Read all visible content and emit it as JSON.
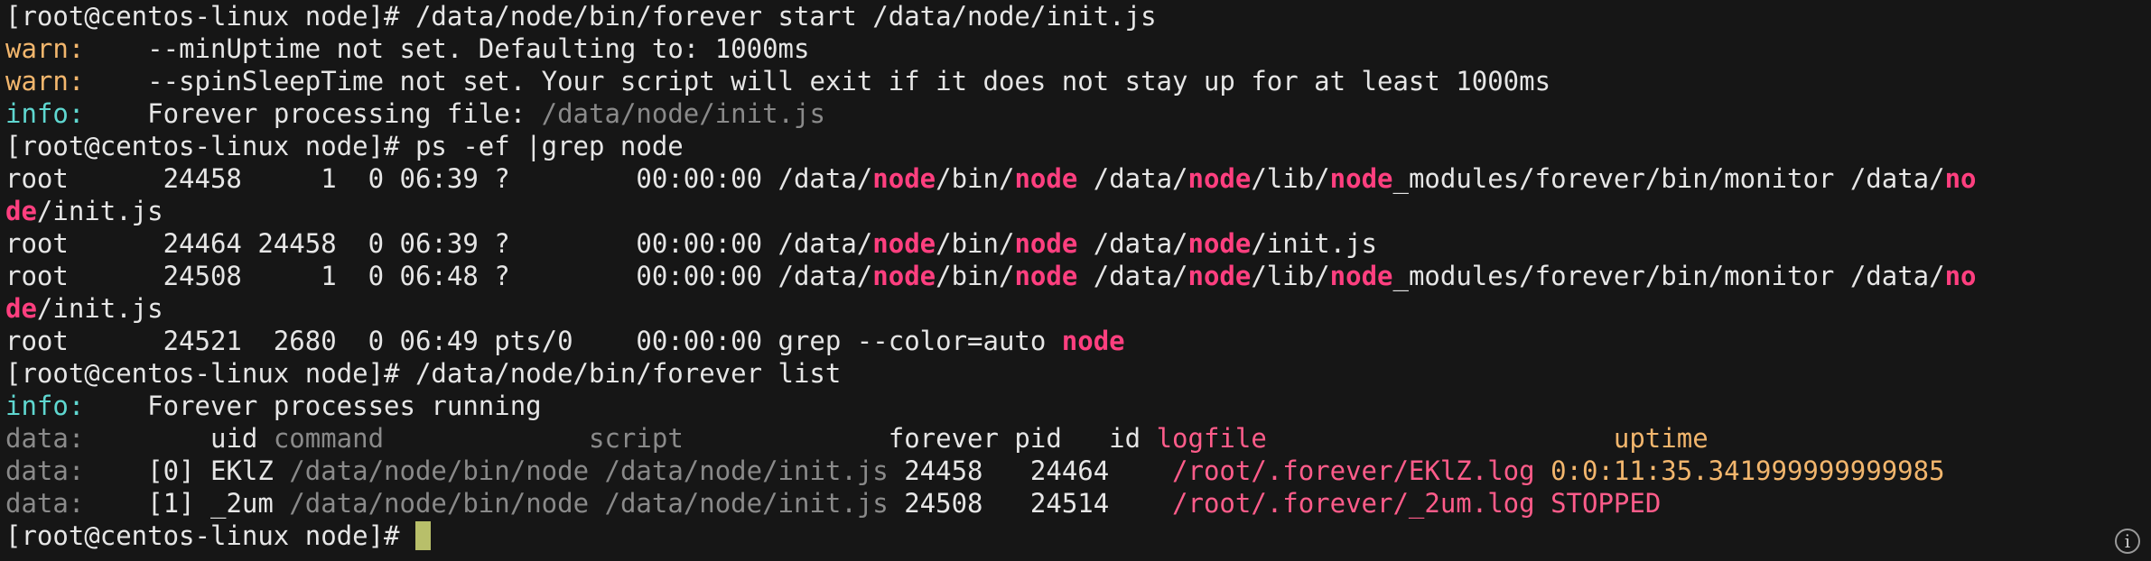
{
  "lines": [
    {
      "segments": [
        {
          "t": "[root@centos-linux node]# /data/node/bin/forever start /data/node/init.js",
          "c": ""
        }
      ]
    },
    {
      "segments": [
        {
          "t": "warn:",
          "c": "warn"
        },
        {
          "t": "    --minUptime not set. Defaulting to: 1000ms",
          "c": ""
        }
      ]
    },
    {
      "segments": [
        {
          "t": "warn:",
          "c": "warn"
        },
        {
          "t": "    --spinSleepTime not set. Your script will exit if it does not stay up for at least 1000ms",
          "c": ""
        }
      ]
    },
    {
      "segments": [
        {
          "t": "info:",
          "c": "info"
        },
        {
          "t": "    Forever processing file: ",
          "c": ""
        },
        {
          "t": "/data/node/init.js",
          "c": "dim"
        }
      ]
    },
    {
      "segments": [
        {
          "t": "[root@centos-linux node]# ps -ef |grep node",
          "c": ""
        }
      ]
    },
    {
      "segments": [
        {
          "t": "root      24458     1  0 06:39 ?        00:00:00 /data/",
          "c": ""
        },
        {
          "t": "node",
          "c": "match"
        },
        {
          "t": "/bin/",
          "c": ""
        },
        {
          "t": "node",
          "c": "match"
        },
        {
          "t": " /data/",
          "c": ""
        },
        {
          "t": "node",
          "c": "match"
        },
        {
          "t": "/lib/",
          "c": ""
        },
        {
          "t": "node",
          "c": "match"
        },
        {
          "t": "_modules/forever/bin/monitor /data/",
          "c": ""
        },
        {
          "t": "no",
          "c": "match"
        }
      ]
    },
    {
      "segments": [
        {
          "t": "de",
          "c": "match"
        },
        {
          "t": "/init.js",
          "c": ""
        }
      ]
    },
    {
      "segments": [
        {
          "t": "root      24464 24458  0 06:39 ?        00:00:00 /data/",
          "c": ""
        },
        {
          "t": "node",
          "c": "match"
        },
        {
          "t": "/bin/",
          "c": ""
        },
        {
          "t": "node",
          "c": "match"
        },
        {
          "t": " /data/",
          "c": ""
        },
        {
          "t": "node",
          "c": "match"
        },
        {
          "t": "/init.js",
          "c": ""
        }
      ]
    },
    {
      "segments": [
        {
          "t": "root      24508     1  0 06:48 ?        00:00:00 /data/",
          "c": ""
        },
        {
          "t": "node",
          "c": "match"
        },
        {
          "t": "/bin/",
          "c": ""
        },
        {
          "t": "node",
          "c": "match"
        },
        {
          "t": " /data/",
          "c": ""
        },
        {
          "t": "node",
          "c": "match"
        },
        {
          "t": "/lib/",
          "c": ""
        },
        {
          "t": "node",
          "c": "match"
        },
        {
          "t": "_modules/forever/bin/monitor /data/",
          "c": ""
        },
        {
          "t": "no",
          "c": "match"
        }
      ]
    },
    {
      "segments": [
        {
          "t": "de",
          "c": "match"
        },
        {
          "t": "/init.js",
          "c": ""
        }
      ]
    },
    {
      "segments": [
        {
          "t": "root      24521  2680  0 06:49 pts/0    00:00:00 grep --color=auto ",
          "c": ""
        },
        {
          "t": "node",
          "c": "match"
        }
      ]
    },
    {
      "segments": [
        {
          "t": "[root@centos-linux node]# /data/node/bin/forever list",
          "c": ""
        }
      ]
    },
    {
      "segments": [
        {
          "t": "info:",
          "c": "info"
        },
        {
          "t": "    Forever processes running",
          "c": ""
        }
      ]
    },
    {
      "segments": [
        {
          "t": "data:",
          "c": "dim"
        },
        {
          "t": "        uid ",
          "c": ""
        },
        {
          "t": "command             script             ",
          "c": "dim"
        },
        {
          "t": "forever pid   id ",
          "c": ""
        },
        {
          "t": "logfile                      ",
          "c": "logc"
        },
        {
          "t": "uptime",
          "c": "upc"
        }
      ]
    },
    {
      "segments": [
        {
          "t": "data:",
          "c": "dim"
        },
        {
          "t": "    [0] EKlZ ",
          "c": ""
        },
        {
          "t": "/data/node/bin/node /data/node/init.js ",
          "c": "dim"
        },
        {
          "t": "24458   24464    ",
          "c": ""
        },
        {
          "t": "/root/.forever/EKlZ.log ",
          "c": "logc"
        },
        {
          "t": "0:0:11:35.341999999999985",
          "c": "upc"
        }
      ]
    },
    {
      "segments": [
        {
          "t": "data:",
          "c": "dim"
        },
        {
          "t": "    [1] _2um ",
          "c": ""
        },
        {
          "t": "/data/node/bin/node /data/node/init.js ",
          "c": "dim"
        },
        {
          "t": "24508   24514    ",
          "c": ""
        },
        {
          "t": "/root/.forever/_2um.log ",
          "c": "logc"
        },
        {
          "t": "STOPPED",
          "c": "stopc"
        }
      ]
    },
    {
      "segments": [
        {
          "t": "[root@centos-linux node]# ",
          "c": ""
        }
      ],
      "cursor": true
    }
  ],
  "info_button": "i",
  "colors": {
    "background": "#161616",
    "text": "#e6e6e6",
    "warn": "#f2b66d",
    "info": "#5fd7d0",
    "dim": "#8a8a8a",
    "match": "#ff3f7f",
    "cursor": "#b8bf6a"
  }
}
